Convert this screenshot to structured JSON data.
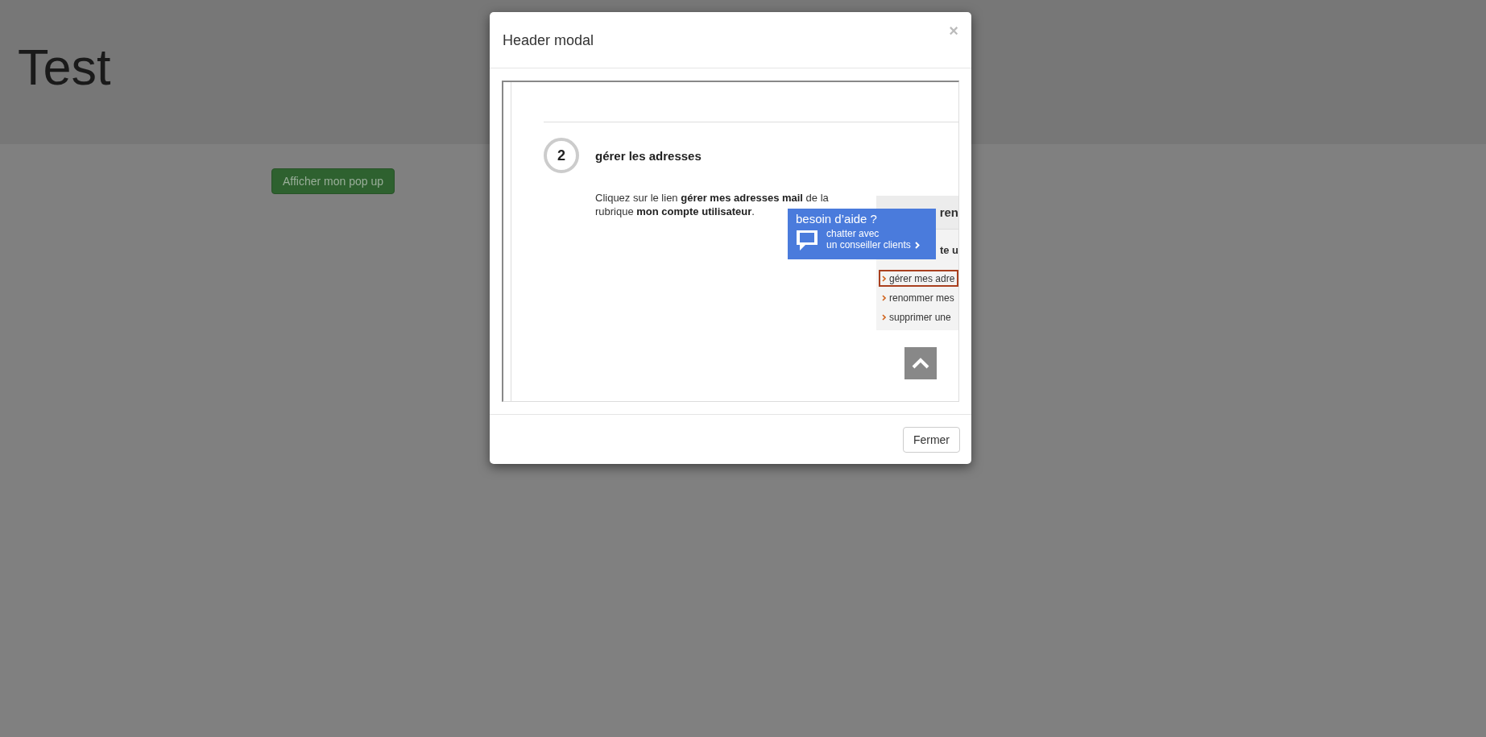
{
  "page": {
    "title": "Test",
    "button": "Afficher mon pop up"
  },
  "modal": {
    "title": "Header modal",
    "close": "×",
    "frame": {
      "step": {
        "number": "2",
        "title": "gérer les adresses",
        "text": "Cliquez sur le lien **gérer mes adresses mail** de la rubrique **mon compte utilisateur**."
      },
      "sidebar": {
        "heading": "ren",
        "subheading": "te u",
        "links": [
          {
            "label": "gérer mes adre",
            "selected": true
          },
          {
            "label": "renommer mes",
            "selected": false
          },
          {
            "label": "supprimer une",
            "selected": false
          }
        ]
      },
      "chat": {
        "title": "besoin d’aide ?",
        "line_1": "chatter avec",
        "line_2": "un conseiller clients"
      }
    },
    "footer_button": "Fermer"
  }
}
